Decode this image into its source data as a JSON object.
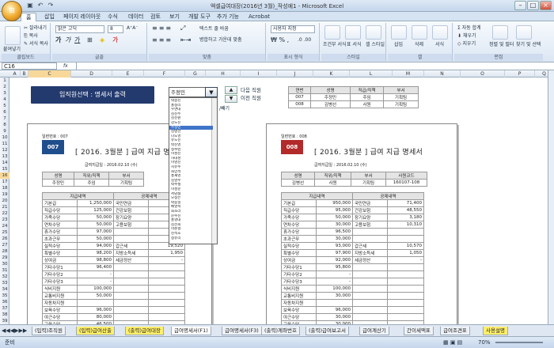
{
  "window": {
    "title": "엑셀급여대장(2016년 3월)_작성예1 - Microsoft Excel"
  },
  "ribbon": {
    "tabs": [
      "홈",
      "삽입",
      "페이지 레이아웃",
      "수식",
      "데이터",
      "검토",
      "보기",
      "개발 도구",
      "추가 기능",
      "Acrobat"
    ],
    "clipboard": {
      "paste": "붙여넣기",
      "cut": "잘라내기",
      "copy": "복사",
      "format_painter": "서식 복사",
      "label": "클립보드"
    },
    "font": {
      "name": "맑은 고딕",
      "size": "8",
      "label": "글꼴"
    },
    "align": {
      "wrap": "텍스트 줄 바꿈",
      "merge": "병합하고 가운데 맞춤",
      "label": "맞춤"
    },
    "number": {
      "format": "사용자 지정",
      "label": "표시 형식"
    },
    "styles": {
      "cond": "조건부 서식",
      "table": "표 서식",
      "cell": "셀 스타일",
      "label": "스타일"
    },
    "cells": {
      "insert": "삽입",
      "delete": "삭제",
      "format": "서식",
      "label": "셀"
    },
    "edit": {
      "autosum": "자동 합계",
      "fill": "채우기",
      "clear": "지우기",
      "sort": "정렬 및 필터",
      "find": "찾기 및 선택",
      "label": "편집"
    }
  },
  "formula_bar": {
    "name_box": "C16",
    "fx": "fx",
    "value": ""
  },
  "columns": [
    "A",
    "B",
    "C",
    "D",
    "E",
    "F",
    "G",
    "H",
    "I",
    "J",
    "K",
    "L",
    "M",
    "N",
    "O",
    "P",
    "Q"
  ],
  "selected_column": "C",
  "selected_row": "16",
  "rows": [
    "1",
    "2",
    "3",
    "4",
    "5",
    "6",
    "7",
    "8",
    "9",
    "10",
    "11",
    "12",
    "13",
    "14",
    "15",
    "16",
    "17",
    "18",
    "19",
    "20",
    "21",
    "22",
    "23",
    "24",
    "25",
    "26",
    "27",
    "28",
    "29",
    "30",
    "31",
    "32",
    "33",
    "34",
    "35",
    "36",
    "37",
    "38",
    "39"
  ],
  "selector": {
    "title": "임직원선택 : 명세서 출력",
    "current": "주정민",
    "next_btn": "다음 직원",
    "prev_btn": "이전 직원",
    "list": [
      "박봉진",
      "홍정리",
      "우면대",
      "김진주",
      "김진원",
      "강도진",
      "주정민",
      "김병선",
      "나도영",
      "유도진",
      "박진영",
      "정수련",
      "이성진",
      "하대성",
      "이영진",
      "지유수",
      "최민석",
      "홍재영",
      "김영수",
      "박수철",
      "이성문",
      "서남철",
      "오정은",
      "박동일",
      "배영숙",
      "최소라",
      "문수진",
      "홍영대",
      "김선희",
      "이준형",
      "진석호",
      "정유리"
    ],
    "selected_index": 6,
    "aside": "/빼기"
  },
  "staff_table": {
    "headers": [
      "연번",
      "성명",
      "직급/직책",
      "부서"
    ],
    "rows": [
      [
        "007",
        "주정민",
        "주임",
        "기획팀"
      ],
      [
        "008",
        "김병선",
        "사원",
        "기획팀"
      ]
    ]
  },
  "pages": [
    {
      "serial_label": "일련번호 : 007",
      "badge": "007",
      "badge_color": "#1f4e8c",
      "title": "[ 2016. 3월분 ] 급여 지급 명세",
      "date": "급여지급일 : 2016.02.10 (수)",
      "info_headers": [
        "성명",
        "직위/직책",
        "부서"
      ],
      "info_values": [
        "주정민",
        "주임",
        "기획팀"
      ],
      "pay_header": "지급내역",
      "ded_header": "공제내역",
      "pay": [
        [
          "기본급",
          "1,250,000"
        ],
        [
          "직급수당",
          "125,000"
        ],
        [
          "가족수당",
          "50,000"
        ],
        [
          "연차수당",
          "50,000"
        ],
        [
          "휴가수당",
          "97,000"
        ],
        [
          "초과근무",
          "50,000"
        ],
        [
          "실적수당",
          "94,000"
        ],
        [
          "특별수당",
          "98,200"
        ],
        [
          "상여금",
          "98,800"
        ],
        [
          "기타수당1",
          "96,400"
        ],
        [
          "기타수당2",
          "-"
        ],
        [
          "기타수당3",
          "-"
        ],
        [
          "식비지원",
          "100,000"
        ],
        [
          "교통비지원",
          "50,000"
        ],
        [
          "자동차지원",
          ""
        ],
        [
          "보육수당",
          "96,000"
        ],
        [
          "야근수당",
          "80,000"
        ],
        [
          "교육수당",
          "46,500"
        ]
      ],
      "ded": [
        [
          "국민연금",
          ""
        ],
        [
          "건강보험",
          ""
        ],
        [
          "장기요양",
          ""
        ],
        [
          "고용보험",
          ""
        ],
        [
          "",
          ""
        ],
        [
          "",
          ""
        ],
        [
          "갑근세",
          "19,520"
        ],
        [
          "지방소득세",
          "1,950"
        ],
        [
          "세금정산",
          "-"
        ]
      ]
    },
    {
      "serial_label": "일련번호 : 008",
      "badge": "008",
      "badge_color": "#b22a2a",
      "title": "[ 2016. 3월분 ] 급여 지급 명세서",
      "date": "급여지급일 : 2016.02.10 (수)",
      "info_headers": [
        "성명",
        "직위/직책",
        "부서",
        "사원코드"
      ],
      "info_values": [
        "김병선",
        "사원",
        "기획팀",
        "160107-108"
      ],
      "pay_header": "지급내역",
      "ded_header": "공제내역",
      "pay": [
        [
          "기본급",
          "950,000"
        ],
        [
          "직급수당",
          "95,000"
        ],
        [
          "가족수당",
          "50,000"
        ],
        [
          "연차수당",
          "30,000"
        ],
        [
          "휴가수당",
          "96,500"
        ],
        [
          "초과근무",
          "30,000"
        ],
        [
          "실적수당",
          "93,000"
        ],
        [
          "특별수당",
          "97,900"
        ],
        [
          "상여금",
          "92,000"
        ],
        [
          "기타수당1",
          "95,800"
        ],
        [
          "기타수당2",
          "-"
        ],
        [
          "기타수당3",
          "-"
        ],
        [
          "식비지원",
          "100,000"
        ],
        [
          "교통비지원",
          "30,000"
        ],
        [
          "자동차지원",
          ""
        ],
        [
          "보육수당",
          "96,000"
        ],
        [
          "야근수당",
          "30,000"
        ],
        [
          "교육수당",
          "30,000"
        ]
      ],
      "ded": [
        [
          "국민연금",
          "71,400"
        ],
        [
          "건강보험",
          "48,550"
        ],
        [
          "장기요양",
          "3,180"
        ],
        [
          "고용보험",
          "10,310"
        ],
        [
          "",
          ""
        ],
        [
          "",
          ""
        ],
        [
          "갑근세",
          "10,570"
        ],
        [
          "지방소득세",
          "1,050"
        ],
        [
          "세금정산",
          "-"
        ]
      ]
    }
  ],
  "sheet_tabs": [
    {
      "label": "(입력)조직원",
      "style": "plain"
    },
    {
      "label": "(입력)급여산출",
      "style": "yel"
    },
    {
      "label": "(출력)급여대장",
      "style": "yel"
    },
    {
      "label": "급여명세서(F1)",
      "style": "act"
    },
    {
      "label": "급여명세서(F3)",
      "style": "plain"
    },
    {
      "label": "(출력)계좌번호",
      "style": "plain"
    },
    {
      "label": "(출력)급여보고서",
      "style": "plain"
    },
    {
      "label": "급여계산기",
      "style": "plain"
    },
    {
      "label": "간이세액표",
      "style": "plain"
    },
    {
      "label": "급여조견표",
      "style": "plain"
    },
    {
      "label": "사용설명",
      "style": "yel"
    }
  ],
  "status": {
    "ready": "준비",
    "zoom": "70%"
  }
}
